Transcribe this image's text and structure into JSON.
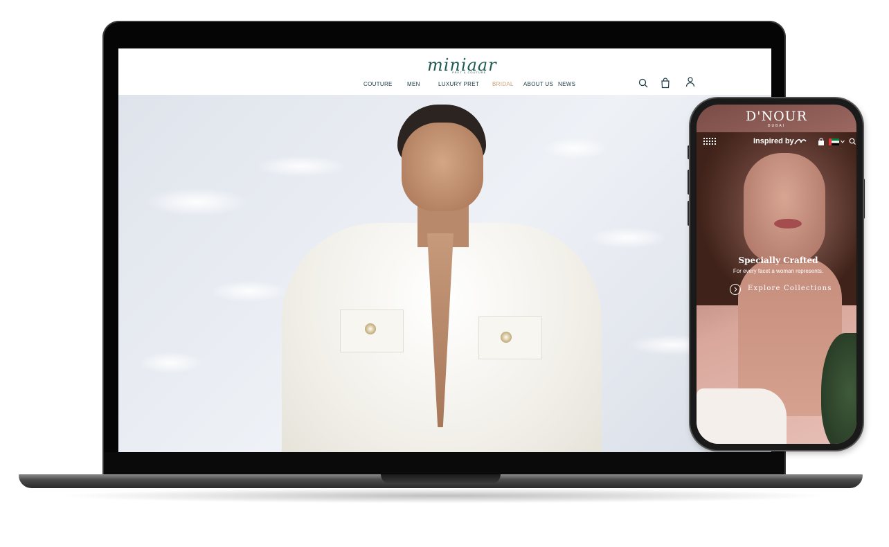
{
  "laptop": {
    "site": {
      "brand": "miniaar",
      "tagline": "PRET & COUTURE",
      "nav": [
        {
          "label": "COUTURE"
        },
        {
          "label": "MEN"
        },
        {
          "label": "LUXURY PRET"
        },
        {
          "label": "BRIDAL",
          "active": true
        },
        {
          "label": "ABOUT US"
        },
        {
          "label": "NEWS"
        }
      ],
      "icons": [
        "search-icon",
        "bag-icon",
        "account-icon"
      ],
      "colors": {
        "brand": "#1e5a52",
        "nav": "#1c3a44",
        "active": "#c89e74"
      }
    }
  },
  "phone": {
    "brand": "D'NOUR",
    "brand_sub": "DUBAI",
    "inspired": "Inspired by",
    "headline": "Specially Crafted",
    "subheadline": "For every facet a woman represents.",
    "cta": "Explore Collections",
    "icons": [
      "menu-grid-icon",
      "bag-icon",
      "uae-flag-icon",
      "chevron-down-icon",
      "search-icon"
    ]
  }
}
